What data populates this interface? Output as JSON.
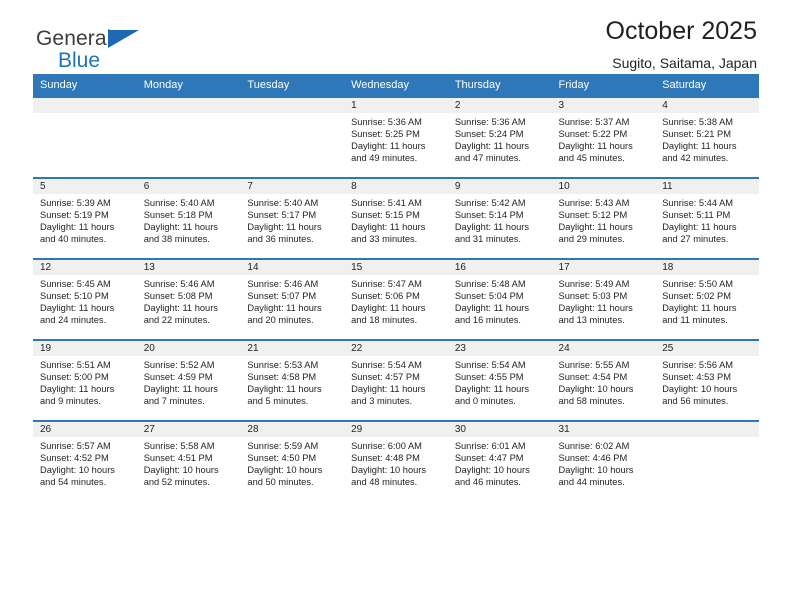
{
  "brand": {
    "line1": "General",
    "line2": "Blue",
    "triangle_color": "#1b68b3",
    "line2_color": "#1b75bb"
  },
  "header": {
    "title": "October 2025",
    "subtitle": "Sugito, Saitama, Japan"
  },
  "calendar": {
    "header_bg": "#2e77b8",
    "daynum_bg": "#f0f0f0",
    "weekday_headers": [
      "Sunday",
      "Monday",
      "Tuesday",
      "Wednesday",
      "Thursday",
      "Friday",
      "Saturday"
    ],
    "weeks": [
      [
        {
          "day": "",
          "sunrise": "",
          "sunset": "",
          "daylight_line1": "",
          "daylight_line2": ""
        },
        {
          "day": "",
          "sunrise": "",
          "sunset": "",
          "daylight_line1": "",
          "daylight_line2": ""
        },
        {
          "day": "",
          "sunrise": "",
          "sunset": "",
          "daylight_line1": "",
          "daylight_line2": ""
        },
        {
          "day": "1",
          "sunrise": "Sunrise: 5:36 AM",
          "sunset": "Sunset: 5:25 PM",
          "daylight_line1": "Daylight: 11 hours",
          "daylight_line2": "and 49 minutes."
        },
        {
          "day": "2",
          "sunrise": "Sunrise: 5:36 AM",
          "sunset": "Sunset: 5:24 PM",
          "daylight_line1": "Daylight: 11 hours",
          "daylight_line2": "and 47 minutes."
        },
        {
          "day": "3",
          "sunrise": "Sunrise: 5:37 AM",
          "sunset": "Sunset: 5:22 PM",
          "daylight_line1": "Daylight: 11 hours",
          "daylight_line2": "and 45 minutes."
        },
        {
          "day": "4",
          "sunrise": "Sunrise: 5:38 AM",
          "sunset": "Sunset: 5:21 PM",
          "daylight_line1": "Daylight: 11 hours",
          "daylight_line2": "and 42 minutes."
        }
      ],
      [
        {
          "day": "5",
          "sunrise": "Sunrise: 5:39 AM",
          "sunset": "Sunset: 5:19 PM",
          "daylight_line1": "Daylight: 11 hours",
          "daylight_line2": "and 40 minutes."
        },
        {
          "day": "6",
          "sunrise": "Sunrise: 5:40 AM",
          "sunset": "Sunset: 5:18 PM",
          "daylight_line1": "Daylight: 11 hours",
          "daylight_line2": "and 38 minutes."
        },
        {
          "day": "7",
          "sunrise": "Sunrise: 5:40 AM",
          "sunset": "Sunset: 5:17 PM",
          "daylight_line1": "Daylight: 11 hours",
          "daylight_line2": "and 36 minutes."
        },
        {
          "day": "8",
          "sunrise": "Sunrise: 5:41 AM",
          "sunset": "Sunset: 5:15 PM",
          "daylight_line1": "Daylight: 11 hours",
          "daylight_line2": "and 33 minutes."
        },
        {
          "day": "9",
          "sunrise": "Sunrise: 5:42 AM",
          "sunset": "Sunset: 5:14 PM",
          "daylight_line1": "Daylight: 11 hours",
          "daylight_line2": "and 31 minutes."
        },
        {
          "day": "10",
          "sunrise": "Sunrise: 5:43 AM",
          "sunset": "Sunset: 5:12 PM",
          "daylight_line1": "Daylight: 11 hours",
          "daylight_line2": "and 29 minutes."
        },
        {
          "day": "11",
          "sunrise": "Sunrise: 5:44 AM",
          "sunset": "Sunset: 5:11 PM",
          "daylight_line1": "Daylight: 11 hours",
          "daylight_line2": "and 27 minutes."
        }
      ],
      [
        {
          "day": "12",
          "sunrise": "Sunrise: 5:45 AM",
          "sunset": "Sunset: 5:10 PM",
          "daylight_line1": "Daylight: 11 hours",
          "daylight_line2": "and 24 minutes."
        },
        {
          "day": "13",
          "sunrise": "Sunrise: 5:46 AM",
          "sunset": "Sunset: 5:08 PM",
          "daylight_line1": "Daylight: 11 hours",
          "daylight_line2": "and 22 minutes."
        },
        {
          "day": "14",
          "sunrise": "Sunrise: 5:46 AM",
          "sunset": "Sunset: 5:07 PM",
          "daylight_line1": "Daylight: 11 hours",
          "daylight_line2": "and 20 minutes."
        },
        {
          "day": "15",
          "sunrise": "Sunrise: 5:47 AM",
          "sunset": "Sunset: 5:06 PM",
          "daylight_line1": "Daylight: 11 hours",
          "daylight_line2": "and 18 minutes."
        },
        {
          "day": "16",
          "sunrise": "Sunrise: 5:48 AM",
          "sunset": "Sunset: 5:04 PM",
          "daylight_line1": "Daylight: 11 hours",
          "daylight_line2": "and 16 minutes."
        },
        {
          "day": "17",
          "sunrise": "Sunrise: 5:49 AM",
          "sunset": "Sunset: 5:03 PM",
          "daylight_line1": "Daylight: 11 hours",
          "daylight_line2": "and 13 minutes."
        },
        {
          "day": "18",
          "sunrise": "Sunrise: 5:50 AM",
          "sunset": "Sunset: 5:02 PM",
          "daylight_line1": "Daylight: 11 hours",
          "daylight_line2": "and 11 minutes."
        }
      ],
      [
        {
          "day": "19",
          "sunrise": "Sunrise: 5:51 AM",
          "sunset": "Sunset: 5:00 PM",
          "daylight_line1": "Daylight: 11 hours",
          "daylight_line2": "and 9 minutes."
        },
        {
          "day": "20",
          "sunrise": "Sunrise: 5:52 AM",
          "sunset": "Sunset: 4:59 PM",
          "daylight_line1": "Daylight: 11 hours",
          "daylight_line2": "and 7 minutes."
        },
        {
          "day": "21",
          "sunrise": "Sunrise: 5:53 AM",
          "sunset": "Sunset: 4:58 PM",
          "daylight_line1": "Daylight: 11 hours",
          "daylight_line2": "and 5 minutes."
        },
        {
          "day": "22",
          "sunrise": "Sunrise: 5:54 AM",
          "sunset": "Sunset: 4:57 PM",
          "daylight_line1": "Daylight: 11 hours",
          "daylight_line2": "and 3 minutes."
        },
        {
          "day": "23",
          "sunrise": "Sunrise: 5:54 AM",
          "sunset": "Sunset: 4:55 PM",
          "daylight_line1": "Daylight: 11 hours",
          "daylight_line2": "and 0 minutes."
        },
        {
          "day": "24",
          "sunrise": "Sunrise: 5:55 AM",
          "sunset": "Sunset: 4:54 PM",
          "daylight_line1": "Daylight: 10 hours",
          "daylight_line2": "and 58 minutes."
        },
        {
          "day": "25",
          "sunrise": "Sunrise: 5:56 AM",
          "sunset": "Sunset: 4:53 PM",
          "daylight_line1": "Daylight: 10 hours",
          "daylight_line2": "and 56 minutes."
        }
      ],
      [
        {
          "day": "26",
          "sunrise": "Sunrise: 5:57 AM",
          "sunset": "Sunset: 4:52 PM",
          "daylight_line1": "Daylight: 10 hours",
          "daylight_line2": "and 54 minutes."
        },
        {
          "day": "27",
          "sunrise": "Sunrise: 5:58 AM",
          "sunset": "Sunset: 4:51 PM",
          "daylight_line1": "Daylight: 10 hours",
          "daylight_line2": "and 52 minutes."
        },
        {
          "day": "28",
          "sunrise": "Sunrise: 5:59 AM",
          "sunset": "Sunset: 4:50 PM",
          "daylight_line1": "Daylight: 10 hours",
          "daylight_line2": "and 50 minutes."
        },
        {
          "day": "29",
          "sunrise": "Sunrise: 6:00 AM",
          "sunset": "Sunset: 4:48 PM",
          "daylight_line1": "Daylight: 10 hours",
          "daylight_line2": "and 48 minutes."
        },
        {
          "day": "30",
          "sunrise": "Sunrise: 6:01 AM",
          "sunset": "Sunset: 4:47 PM",
          "daylight_line1": "Daylight: 10 hours",
          "daylight_line2": "and 46 minutes."
        },
        {
          "day": "31",
          "sunrise": "Sunrise: 6:02 AM",
          "sunset": "Sunset: 4:46 PM",
          "daylight_line1": "Daylight: 10 hours",
          "daylight_line2": "and 44 minutes."
        },
        {
          "day": "",
          "sunrise": "",
          "sunset": "",
          "daylight_line1": "",
          "daylight_line2": ""
        }
      ]
    ]
  }
}
